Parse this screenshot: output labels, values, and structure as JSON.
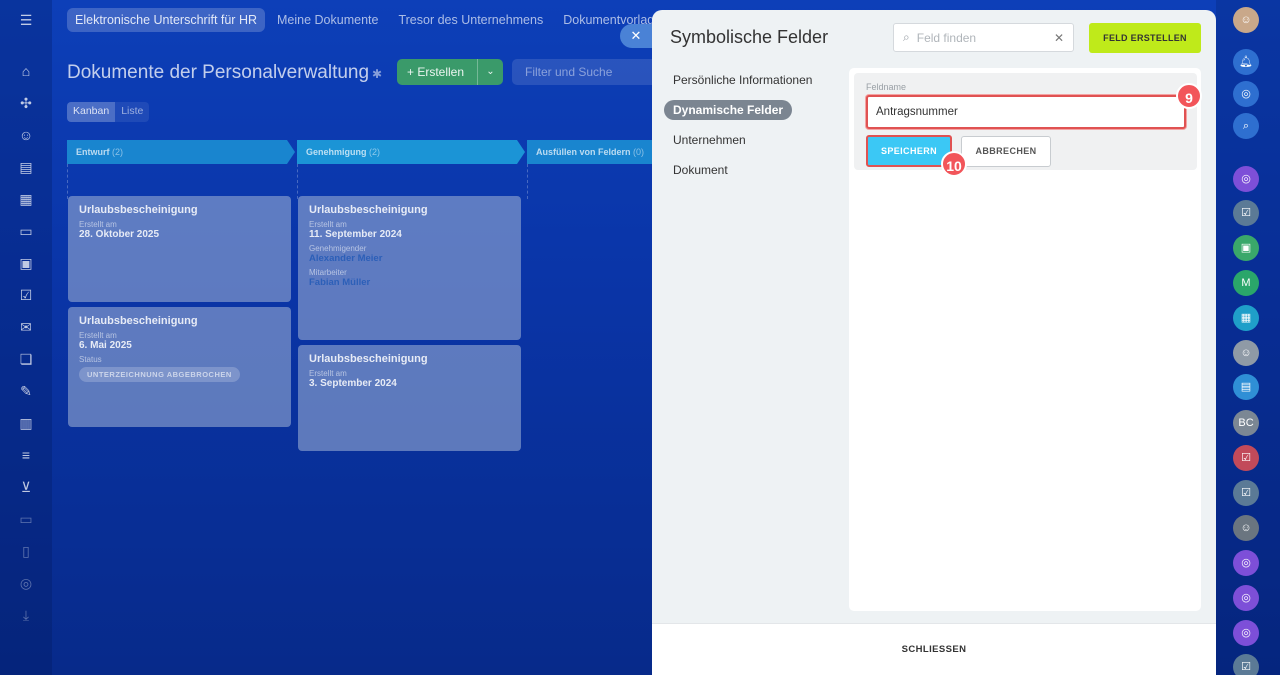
{
  "topnav": {
    "items": [
      {
        "label": "Elektronische Unterschrift für HR",
        "active": true
      },
      {
        "label": "Meine Dokumente",
        "active": false
      },
      {
        "label": "Tresor des Unternehmens",
        "active": false
      },
      {
        "label": "Dokumentvorlagen",
        "active": false
      }
    ]
  },
  "page": {
    "title": "Dokumente der Personalverwaltung",
    "create_label": "+ Erstellen",
    "filter_placeholder": "Filter und Suche",
    "view_tabs": [
      "Kanban",
      "Liste"
    ]
  },
  "kanban": {
    "columns": [
      {
        "name": "Entwurf",
        "count": "(2)",
        "color": "#1fa5dd"
      },
      {
        "name": "Genehmigung",
        "count": "(2)",
        "color": "#1fa5dd"
      },
      {
        "name": "Ausfüllen von Feldern",
        "count": "(0)",
        "color": "#1fa5dd"
      }
    ],
    "cards": [
      {
        "title": "Urlaubsbescheinigung",
        "created_label": "Erstellt am",
        "created": "28. Oktober 2025"
      },
      {
        "title": "Urlaubsbescheinigung",
        "created_label": "Erstellt am",
        "created": "6. Mai 2025",
        "status_label": "Status",
        "status": "UNTERZEICHNUNG ABGEBROCHEN"
      },
      {
        "title": "Urlaubsbescheinigung",
        "created_label": "Erstellt am",
        "created": "11. September 2024",
        "approver_label": "Genehmigender",
        "approver": "Alexander Meier",
        "employee_label": "Mitarbeiter",
        "employee": "Fabian Müller"
      },
      {
        "title": "Urlaubsbescheinigung",
        "created_label": "Erstellt am",
        "created": "3. September 2024"
      }
    ]
  },
  "panel": {
    "title": "Symbolische Felder",
    "search_placeholder": "Feld finden",
    "create_field_label": "FELD ERSTELLEN",
    "menu": [
      {
        "label": "Persönliche Informationen",
        "active": false
      },
      {
        "label": "Dynamische Felder",
        "active": true
      },
      {
        "label": "Unternehmen",
        "active": false
      },
      {
        "label": "Dokument",
        "active": false
      }
    ],
    "form": {
      "field_label": "Feldname",
      "field_value": "Antragsnummer",
      "save_label": "SPEICHERN",
      "cancel_label": "ABBRECHEN"
    },
    "steps": {
      "input_step": "9",
      "save_step": "10"
    },
    "close_label": "SCHLIESSEN"
  },
  "right_bar": {
    "initials_m": "M",
    "initials_bc": "BC"
  },
  "colors": {
    "accent_green": "#bfea1a",
    "save_blue": "#3bc8f5",
    "highlight_red": "#e05252"
  }
}
